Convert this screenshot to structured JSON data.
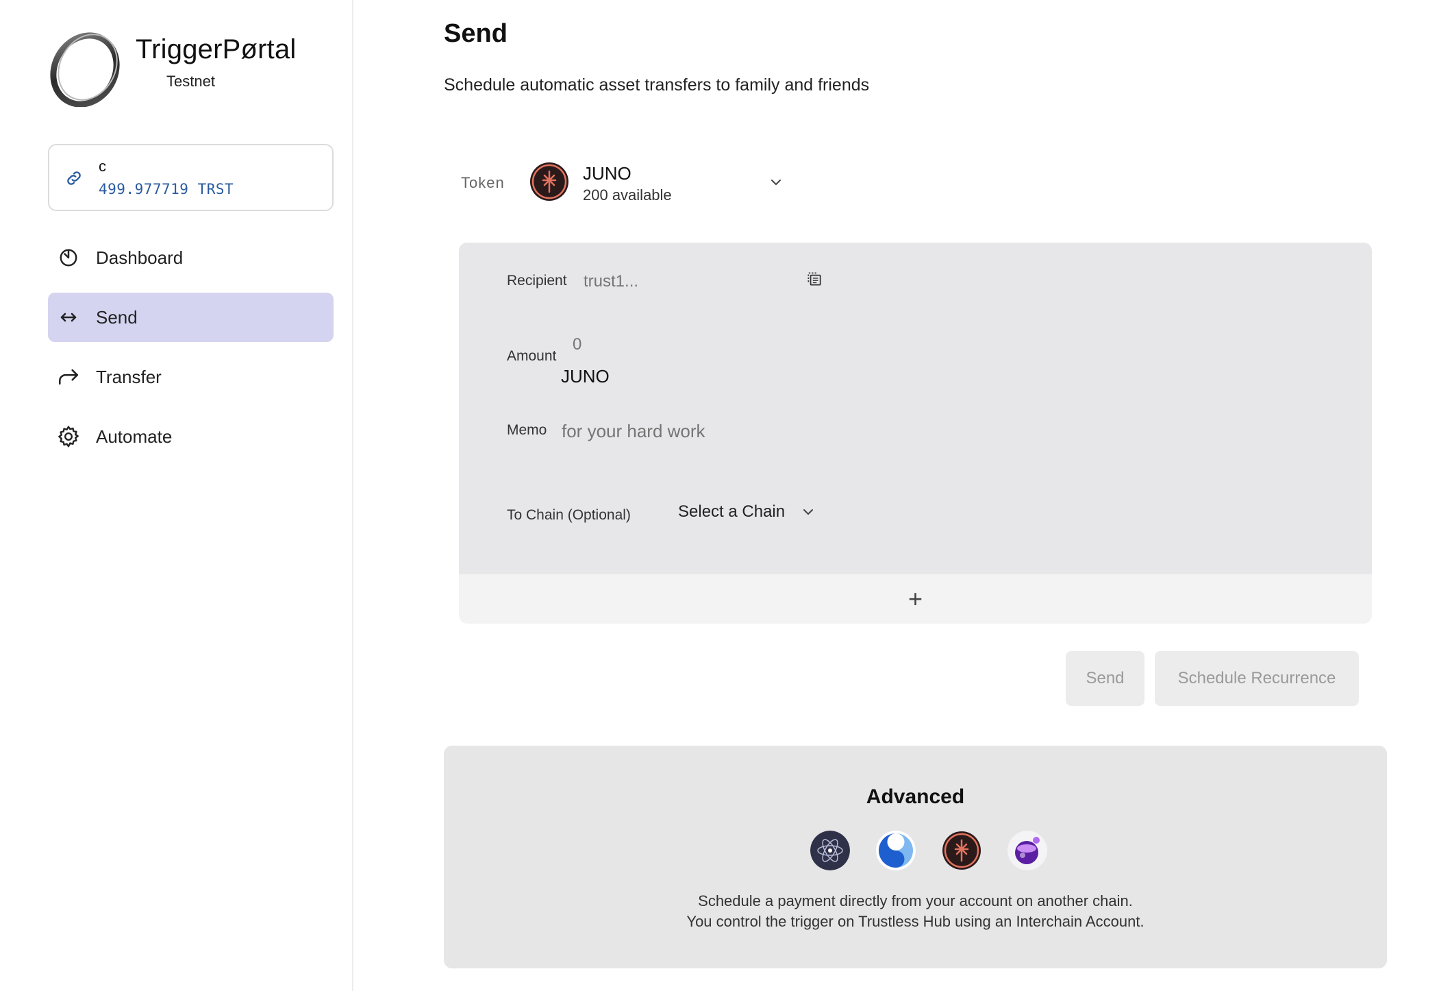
{
  "brand": {
    "name": "TriggerPørtal",
    "network": "Testnet"
  },
  "wallet": {
    "name": "c",
    "balance": "499.977719 TRST"
  },
  "nav": {
    "items": [
      {
        "label": "Dashboard",
        "icon": "dashboard-icon",
        "active": false
      },
      {
        "label": "Send",
        "icon": "arrows-horizontal-icon",
        "active": true
      },
      {
        "label": "Transfer",
        "icon": "forward-arrow-icon",
        "active": false
      },
      {
        "label": "Automate",
        "icon": "gear-icon",
        "active": false
      }
    ]
  },
  "page": {
    "title": "Send",
    "subtitle": "Schedule automatic asset transfers to family and friends"
  },
  "token": {
    "label": "Token",
    "name": "JUNO",
    "available": "200 available",
    "icon": "juno-token-icon"
  },
  "form": {
    "recipient_label": "Recipient",
    "recipient_placeholder": "trust1...",
    "amount_label": "Amount",
    "amount_placeholder": "0",
    "amount_denom": "JUNO",
    "memo_label": "Memo",
    "memo_placeholder": "for your hard work",
    "chain_label": "To Chain (Optional)",
    "chain_select": "Select a Chain",
    "add_symbol": "+"
  },
  "buttons": {
    "send": "Send",
    "schedule": "Schedule Recurrence"
  },
  "advanced": {
    "title": "Advanced",
    "chains": [
      "cosmos-hub-icon",
      "persistence-icon",
      "juno-icon",
      "osmosis-icon"
    ],
    "desc_line1": "Schedule a payment directly from your account on another chain.",
    "desc_line2": "You control the trigger on Trustless Hub using an Interchain Account."
  },
  "colors": {
    "active_nav": "#d4d4f0",
    "balance_text": "#2a5aa0",
    "juno_accent": "#e3735e",
    "card_bg": "#e7e7e9"
  }
}
